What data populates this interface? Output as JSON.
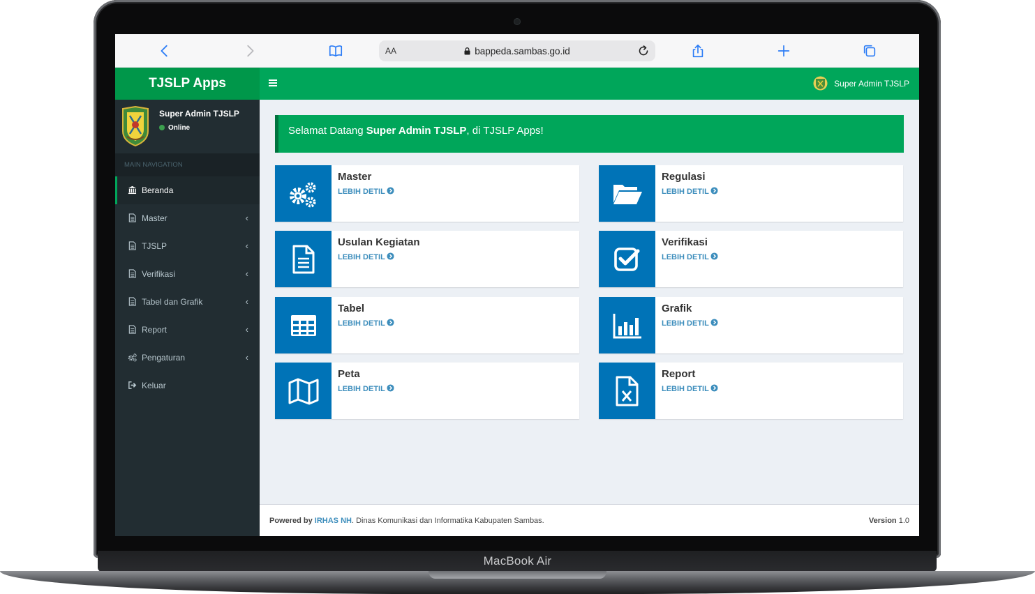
{
  "device": {
    "label": "MacBook Air"
  },
  "browser": {
    "aa_label": "AA",
    "url": "bappeda.sambas.go.id",
    "icons": [
      "back-icon",
      "forward-icon",
      "bookmarks-icon",
      "lock-icon",
      "reload-icon",
      "share-icon",
      "new-tab-icon",
      "tabs-icon"
    ]
  },
  "app": {
    "title": "TJSLP Apps"
  },
  "user": {
    "name": "Super Admin TJSLP",
    "status": "Online"
  },
  "sidebar": {
    "header": "MAIN NAVIGATION",
    "items": [
      {
        "label": "Beranda",
        "icon": "bank-icon",
        "active": true,
        "expandable": false
      },
      {
        "label": "Master",
        "icon": "file-icon",
        "active": false,
        "expandable": true
      },
      {
        "label": "TJSLP",
        "icon": "file-icon",
        "active": false,
        "expandable": true
      },
      {
        "label": "Verifikasi",
        "icon": "file-icon",
        "active": false,
        "expandable": true
      },
      {
        "label": "Tabel dan Grafik",
        "icon": "file-icon",
        "active": false,
        "expandable": true
      },
      {
        "label": "Report",
        "icon": "file-icon",
        "active": false,
        "expandable": true
      },
      {
        "label": "Pengaturan",
        "icon": "cogs-icon",
        "active": false,
        "expandable": true
      },
      {
        "label": "Keluar",
        "icon": "sign-out-icon",
        "active": false,
        "expandable": false
      }
    ],
    "chevron": "‹"
  },
  "topbar": {
    "user_name": "Super Admin TJSLP",
    "menu_icon": "hamburger-icon"
  },
  "welcome": {
    "prefix": "Selamat Datang ",
    "name": "Super Admin TJSLP",
    "suffix": ", di TJSLP Apps!"
  },
  "cards": [
    {
      "title": "Master",
      "link": "LEBIH DETIL",
      "icon": "cogs-icon"
    },
    {
      "title": "Regulasi",
      "link": "LEBIH DETIL",
      "icon": "folder-open-icon"
    },
    {
      "title": "Usulan Kegiatan",
      "link": "LEBIH DETIL",
      "icon": "document-icon"
    },
    {
      "title": "Verifikasi",
      "link": "LEBIH DETIL",
      "icon": "check-square-icon"
    },
    {
      "title": "Tabel",
      "link": "LEBIH DETIL",
      "icon": "table-icon"
    },
    {
      "title": "Grafik",
      "link": "LEBIH DETIL",
      "icon": "bar-chart-icon"
    },
    {
      "title": "Peta",
      "link": "LEBIH DETIL",
      "icon": "map-icon"
    },
    {
      "title": "Report",
      "link": "LEBIH DETIL",
      "icon": "file-excel-icon"
    }
  ],
  "footer": {
    "powered_prefix": "Powered by ",
    "powered_link": "IRHAS NH",
    "powered_suffix": ". Dinas Komunikasi dan Informatika Kabupaten Sambas.",
    "version_label": "Version",
    "version_value": "1.0"
  },
  "colors": {
    "brand_green": "#00a65a",
    "logo_green": "#00974a",
    "card_blue": "#0073b7",
    "link_blue": "#3c8dbc",
    "sidebar_dark": "#222d32"
  }
}
